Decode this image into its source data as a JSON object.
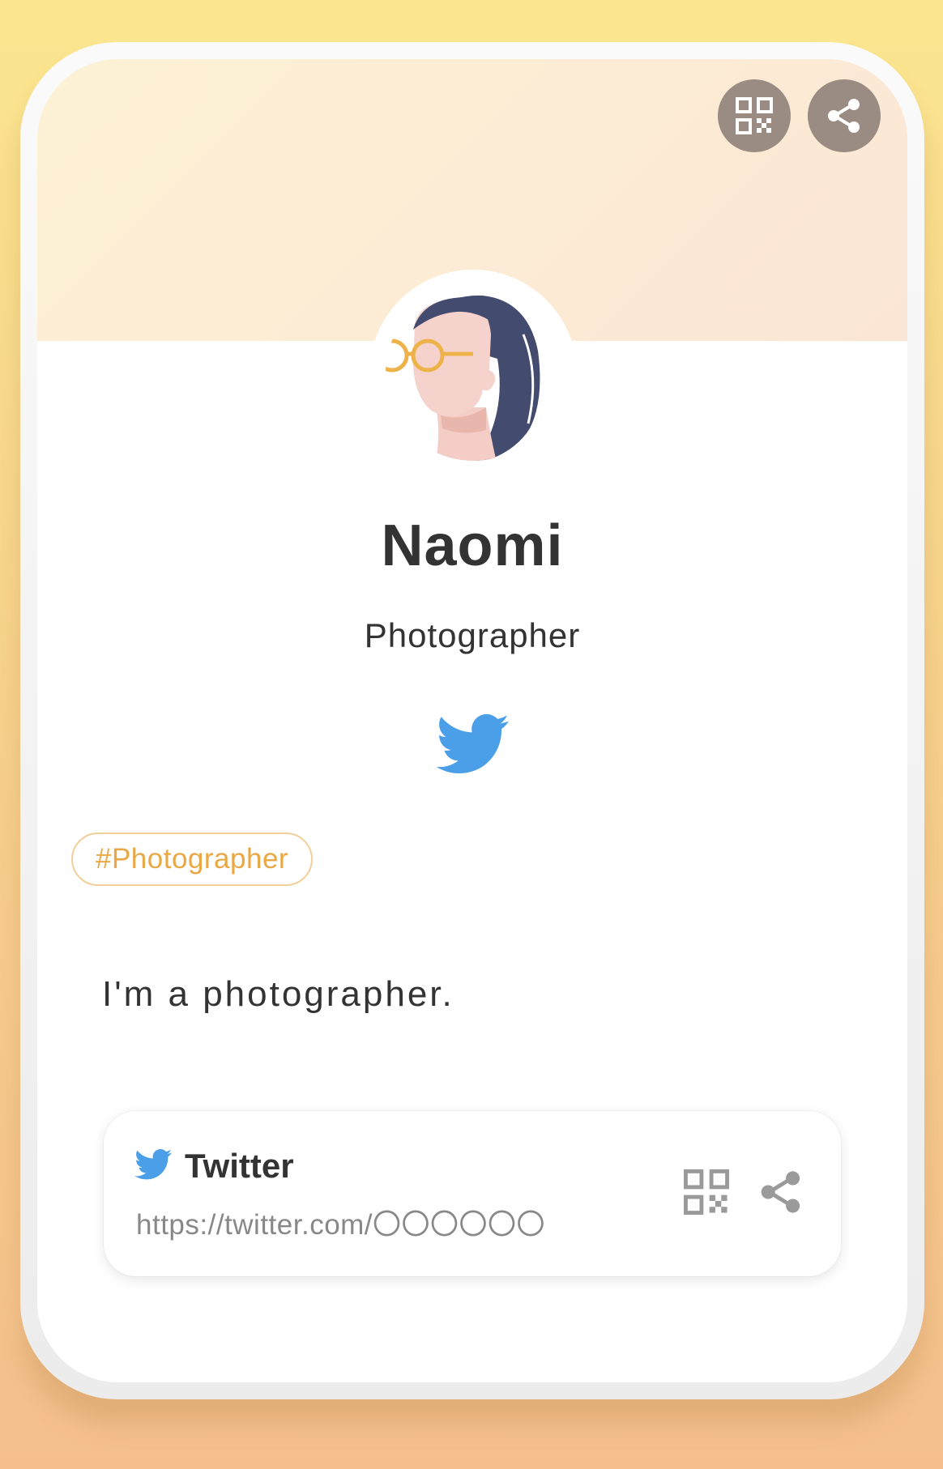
{
  "profile": {
    "name": "Naomi",
    "title": "Photographer",
    "tag": "#Photographer",
    "bio": "I'm a photographer."
  },
  "header": {
    "qr_icon": "qr-code-icon",
    "share_icon": "share-icon"
  },
  "social": {
    "icon": "twitter-bird-icon"
  },
  "link_card": {
    "title": "Twitter",
    "url": "https://twitter.com/〇〇〇〇〇〇",
    "icon": "twitter-bird-icon",
    "qr_icon": "qr-code-icon",
    "share_icon": "share-icon"
  },
  "colors": {
    "twitter_blue": "#4a9fe8",
    "tag_text": "#e9a845",
    "header_button": "#9a8c82",
    "text_dark": "#333333",
    "text_muted": "#888888"
  }
}
